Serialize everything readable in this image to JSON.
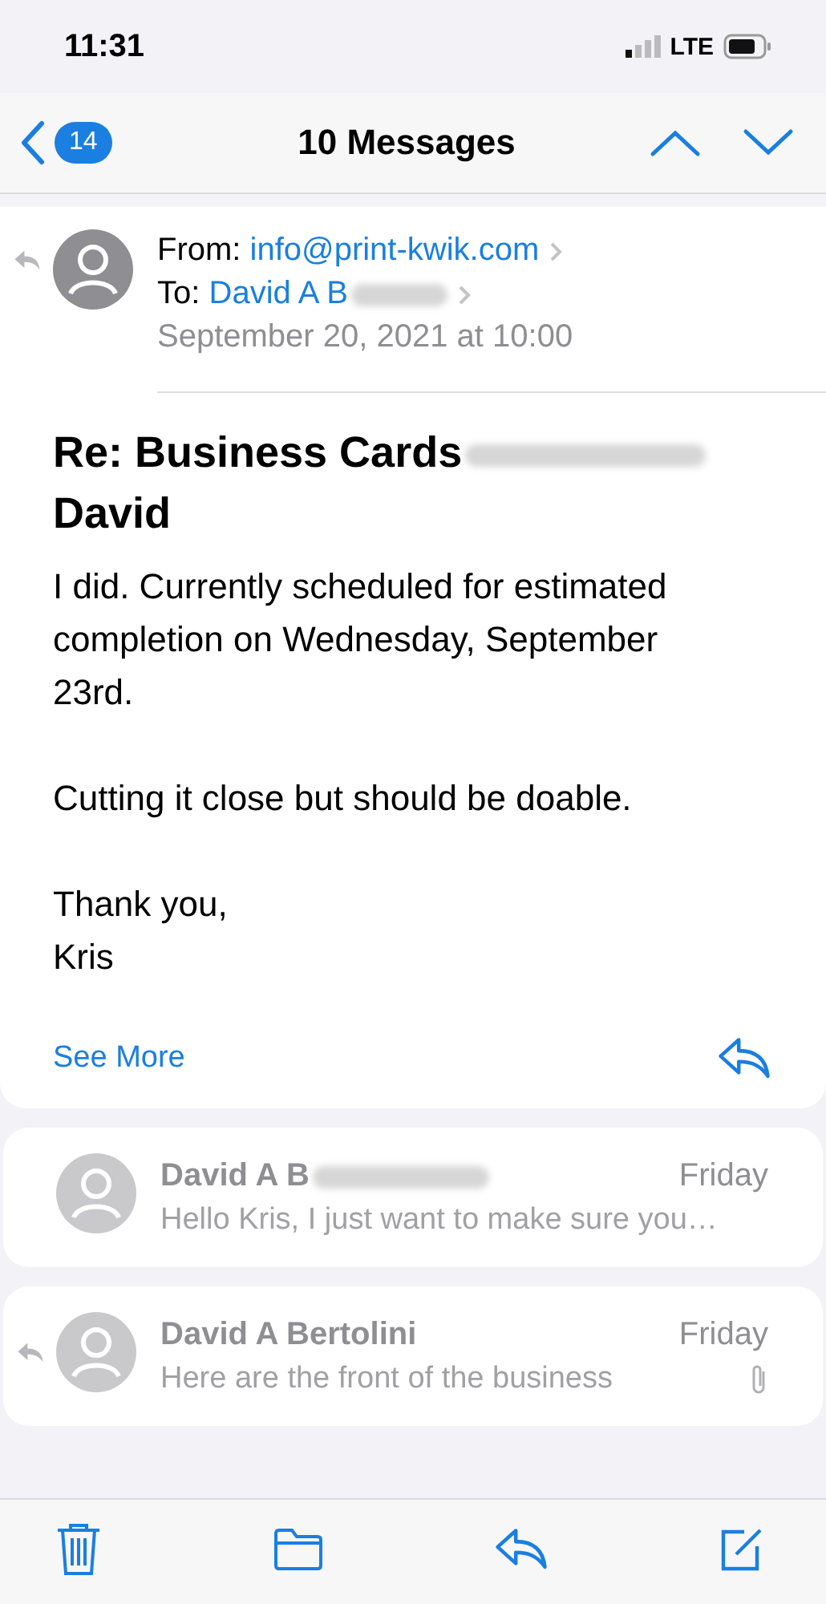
{
  "status_bar": {
    "time": "11:31",
    "network": "LTE"
  },
  "nav": {
    "back_count": "14",
    "title": "10 Messages"
  },
  "messages": [
    {
      "kind": "expanded",
      "replied": true,
      "from_label": "From:",
      "from": "info@print-kwik.com",
      "to_label": "To:",
      "to": "David A B",
      "date": "September 20, 2021 at 10:00",
      "subject": [
        "Re: Business Cards",
        "David"
      ],
      "body": [
        "I did. Currently scheduled for estimated completion on Wednesday, September 23rd.",
        "Cutting it close but should be doable.",
        "Thank you,\nKris"
      ],
      "see_more": "See More"
    },
    {
      "kind": "collapsed",
      "replied": false,
      "attachment": false,
      "sender": "David A B",
      "date": "Friday",
      "preview": "Hello Kris, I just want to make sure you…"
    },
    {
      "kind": "collapsed",
      "replied": true,
      "attachment": true,
      "sender": "David A Bertolini",
      "date": "Friday",
      "preview": "Here are the front of the business"
    }
  ]
}
